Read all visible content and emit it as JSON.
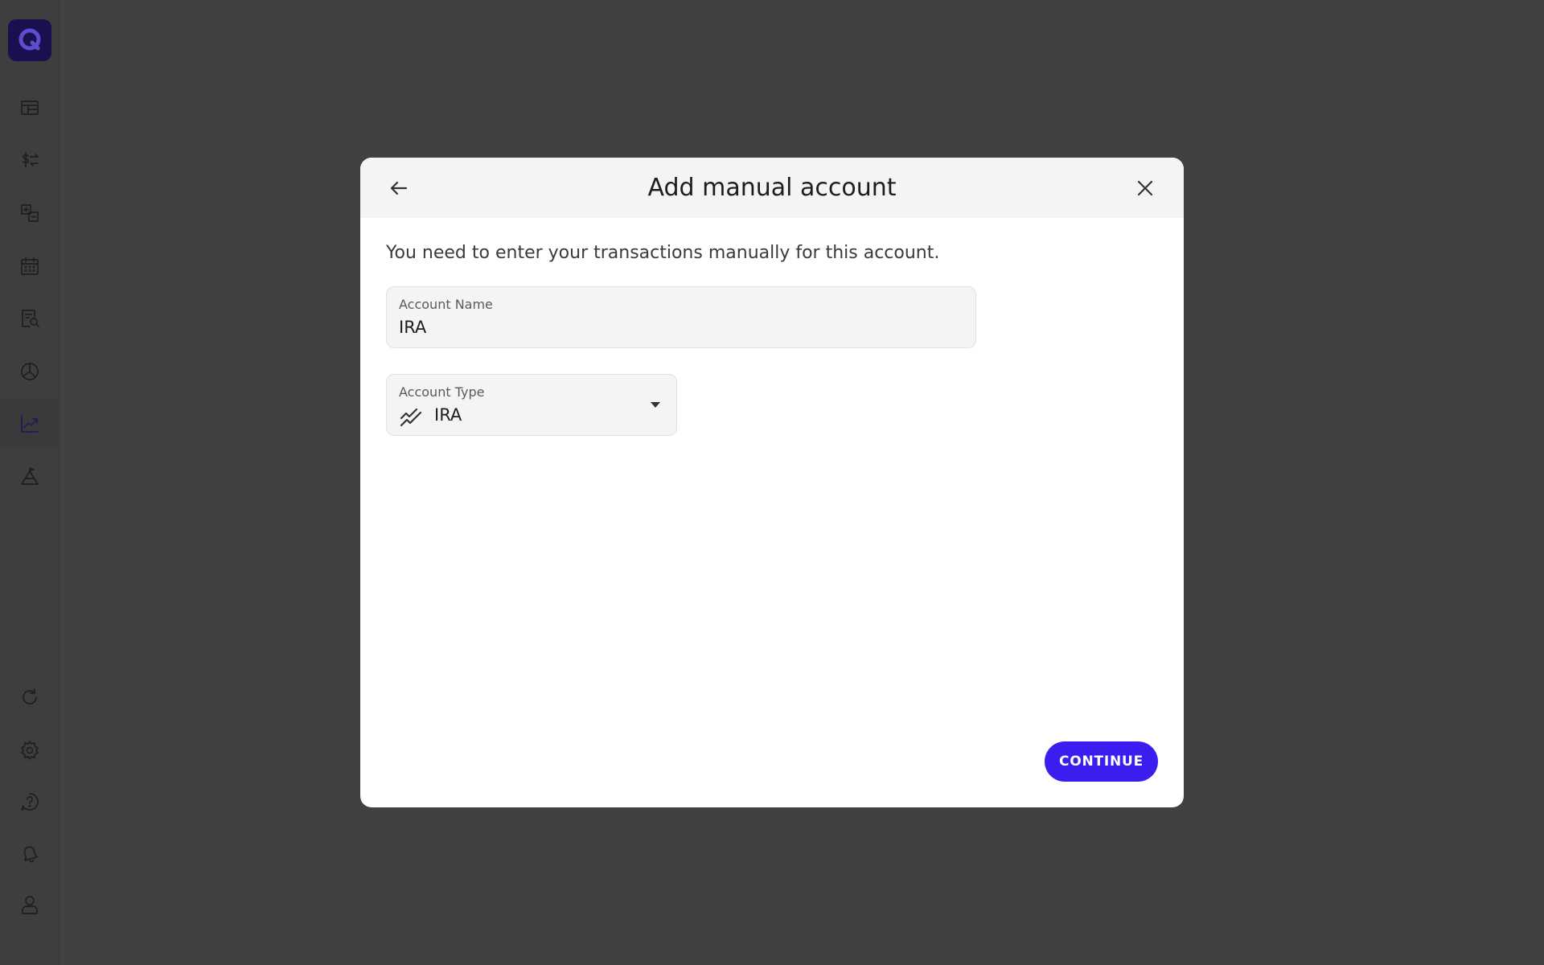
{
  "sidebar": {
    "logo_icon": "quicken-q-logo",
    "nav_items": [
      {
        "icon": "dashboard-icon"
      },
      {
        "icon": "transactions-transfer-icon"
      },
      {
        "icon": "categories-icon"
      },
      {
        "icon": "calendar-icon"
      },
      {
        "icon": "report-search-icon"
      },
      {
        "icon": "pie-chart-icon"
      },
      {
        "icon": "investments-chart-icon",
        "active": true
      },
      {
        "icon": "planning-icon"
      }
    ],
    "bottom_items": [
      {
        "icon": "refresh-icon"
      },
      {
        "icon": "settings-gear-icon"
      },
      {
        "icon": "help-icon"
      },
      {
        "icon": "notifications-bell-icon"
      },
      {
        "icon": "profile-icon"
      }
    ]
  },
  "modal": {
    "title": "Add manual account",
    "back_icon": "arrow-left-icon",
    "close_icon": "close-icon",
    "description": "You need to enter your transactions manually for this account.",
    "account_name": {
      "label": "Account Name",
      "value": "IRA"
    },
    "account_type": {
      "label": "Account Type",
      "value": "IRA",
      "icon": "investment-trend-icon"
    },
    "continue_label": "CONTINUE"
  },
  "colors": {
    "accent": "#3b1df0",
    "overlay_background": "#414141",
    "header_background": "#f3f4f6",
    "logo_background": "#1a1050"
  }
}
